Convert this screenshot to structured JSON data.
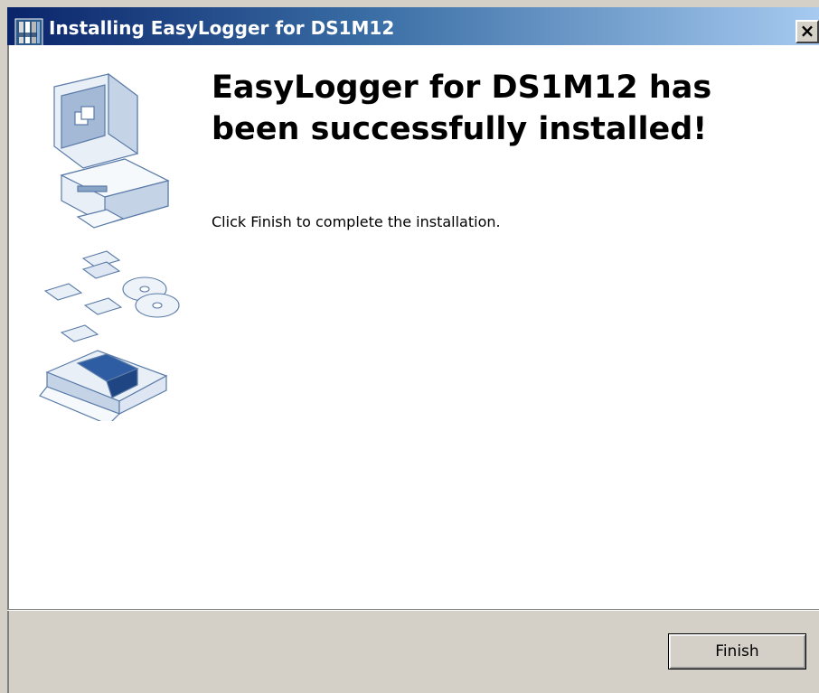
{
  "window": {
    "title": "Installing EasyLogger for DS1M12",
    "close_label": "×"
  },
  "content": {
    "heading": "EasyLogger for DS1M12 has been successfully installed!",
    "message": "Click Finish to complete the installation."
  },
  "footer": {
    "finish_label": "Finish"
  },
  "icons": {
    "app": "installer-icon",
    "hero": "computer-setup-illustration"
  },
  "colors": {
    "titlebar_start": "#0a246a",
    "titlebar_end": "#a6caf0",
    "dialog_face": "#d4d0c8",
    "content_bg": "#ffffff"
  }
}
